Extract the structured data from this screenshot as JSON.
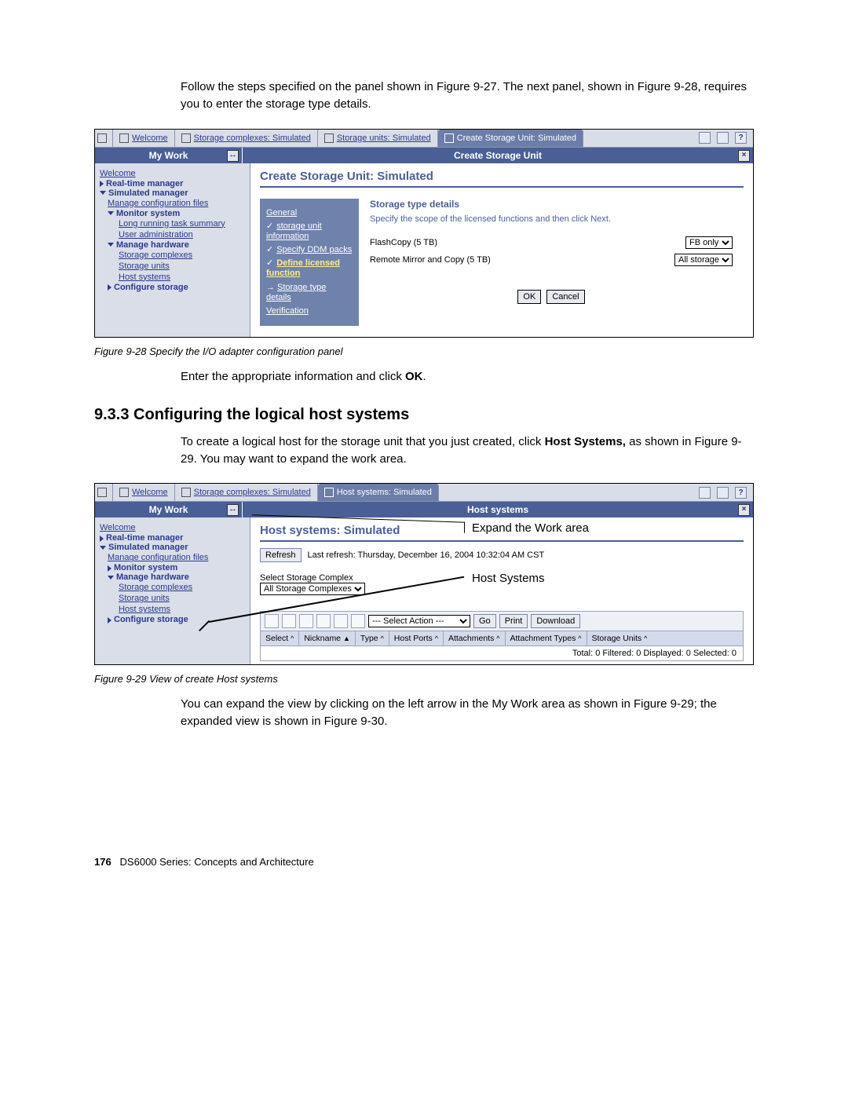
{
  "intro1": "Follow the steps specified on the panel shown in Figure 9-27. The next panel, shown in Figure 9-28, requires you to enter the storage type details.",
  "fig28": {
    "tabs": {
      "welcome": "Welcome",
      "complexes": "Storage complexes: Simulated",
      "units": "Storage units: Simulated",
      "active": "Create Storage Unit: Simulated"
    },
    "hb_left": "My Work",
    "hb_right": "Create Storage Unit",
    "page_title": "Create Storage Unit: Simulated",
    "sidebar": {
      "welcome": "Welcome",
      "rtm": "Real-time manager",
      "sim": "Simulated manager",
      "mcf": "Manage configuration files",
      "ms": "Monitor system",
      "lrs": "Long running task summary",
      "ua": "User administration",
      "mh": "Manage hardware",
      "sc": "Storage complexes",
      "su": "Storage units",
      "hs": "Host systems",
      "cs": "Configure storage"
    },
    "wizard": {
      "general": "General",
      "storage": "storage unit information",
      "ddm": "Specify DDM packs",
      "define": "Define licensed function",
      "type": "Storage type details",
      "verify": "Verification"
    },
    "section_title": "Storage type details",
    "section_desc": "Specify the scope of the licensed functions and then click Next.",
    "row1": "FlashCopy (5 TB)",
    "row1_sel": "FB only",
    "row2": "Remote Mirror and Copy (5 TB)",
    "row2_sel": "All storage",
    "ok": "OK",
    "cancel": "Cancel"
  },
  "caption28": "Figure 9-28   Specify the I/O adapter configuration panel",
  "after28_a": "Enter the appropriate information and click ",
  "after28_b": "OK",
  "after28_c": ".",
  "h933": "9.3.3  Configuring the logical host systems",
  "p933_a": "To create a logical host for the storage unit that you just created, click ",
  "p933_b": "Host Systems,",
  "p933_c": " as shown in Figure 9-29. You may want to expand the work area.",
  "fig29": {
    "tabs": {
      "welcome": "Welcome",
      "complexes": "Storage complexes: Simulated",
      "active": "Host systems: Simulated"
    },
    "hb_left": "My Work",
    "hb_right": "Host systems",
    "page_title": "Host systems: Simulated",
    "refresh": "Refresh",
    "last_refresh": "Last refresh: Thursday, December 16, 2004 10:32:04 AM CST",
    "select_label": "Select Storage Complex",
    "select_val": "All Storage Complexes",
    "action_default": "--- Select Action ---",
    "go": "Go",
    "print": "Print",
    "download": "Download",
    "cols": {
      "select": "Select",
      "nickname": "Nickname",
      "type": "Type",
      "hostports": "Host Ports",
      "attachments": "Attachments",
      "attachtypes": "Attachment Types",
      "storageunits": "Storage Units"
    },
    "footer": "Total: 0   Filtered: 0   Displayed: 0   Selected: 0",
    "anno1": "Expand the Work area",
    "anno2": "Host Systems"
  },
  "caption29": "Figure 9-29   View of create Host systems",
  "after29": "You can expand the view by clicking on the left arrow in the My Work area as shown in Figure 9-29; the expanded view is shown in Figure 9-30.",
  "footer_page": "176",
  "footer_title": "DS6000 Series: Concepts and Architecture"
}
